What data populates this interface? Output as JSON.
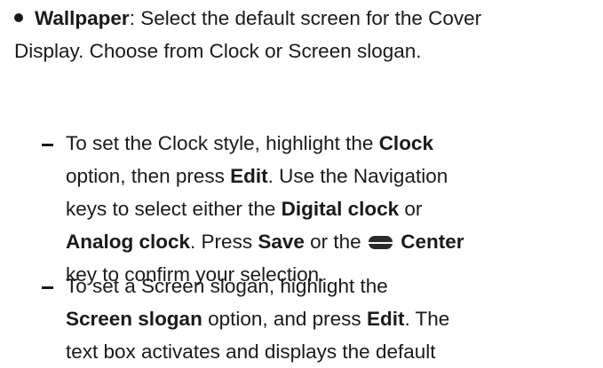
{
  "wallpaper": {
    "term": "Wallpaper",
    "desc_1": ": Select the default screen for the Cover",
    "desc_2": "Display. Choose from Clock or Screen slogan."
  },
  "clock_step": {
    "t1": "To set the Clock style, highlight the ",
    "clock": "Clock",
    "t2": "option, then press ",
    "edit": "Edit",
    "t3": ". Use the Navigation",
    "t4": "keys to select either the ",
    "digital": "Digital clock",
    "t5": " or",
    "analog": "Analog clock",
    "t6": ". Press ",
    "save": "Save",
    "t7": " or the ",
    "center": "Center",
    "center_icon": "center-key-icon",
    "t8": "key to confirm your selection."
  },
  "slogan_step": {
    "t1": "To set a Screen slogan, highlight the",
    "slogan": "Screen slogan",
    "t2": " option, and press ",
    "edit": "Edit",
    "t3": ". The",
    "t4": "text box activates and displays the default"
  }
}
